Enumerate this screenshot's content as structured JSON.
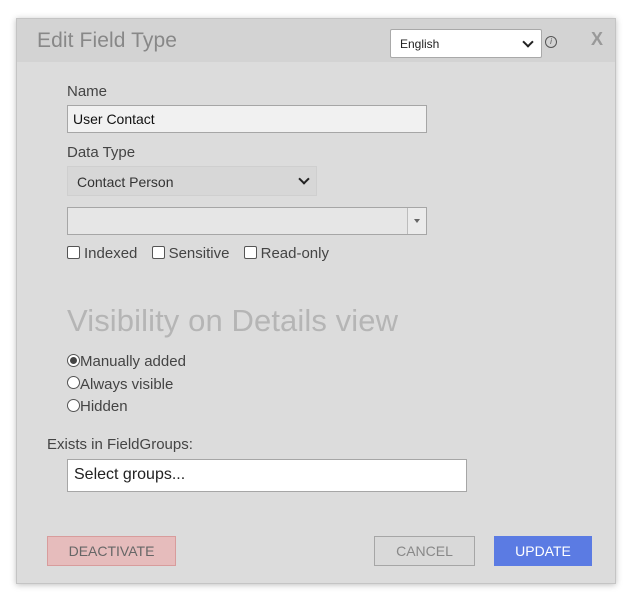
{
  "dialog": {
    "title": "Edit Field Type",
    "language_select": {
      "value": "English"
    },
    "info_icon_glyph": "i",
    "close_label": "X"
  },
  "form": {
    "name_label": "Name",
    "name_value": "User Contact",
    "data_type_label": "Data Type",
    "data_type_value": "Contact Person",
    "secondary_select_value": "",
    "checkboxes": [
      {
        "label": "Indexed",
        "checked": false
      },
      {
        "label": "Sensitive",
        "checked": false
      },
      {
        "label": "Read-only",
        "checked": false
      }
    ],
    "visibility_title": "Visibility on Details view",
    "visibility_options": [
      {
        "label": "Manually added",
        "selected": true
      },
      {
        "label": "Always visible",
        "selected": false
      },
      {
        "label": "Hidden",
        "selected": false
      }
    ],
    "field_groups_label": "Exists in FieldGroups:",
    "field_groups_placeholder": "Select groups..."
  },
  "actions": {
    "deactivate": "DEACTIVATE",
    "cancel": "CANCEL",
    "update": "UPDATE"
  },
  "colors": {
    "dialog_bg": "#dcdcdc",
    "header_bg": "#d3d3d3",
    "update_button": "#5b7be3",
    "deactivate_button": "#e6bcbc"
  },
  "icons": {
    "info": "info-icon",
    "close": "close-icon",
    "dropdown": "chevron-down-icon"
  }
}
